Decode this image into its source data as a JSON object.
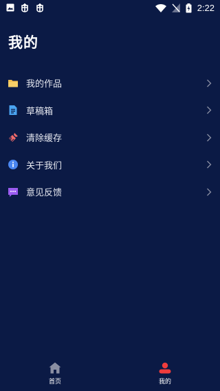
{
  "status_bar": {
    "time": "2:22",
    "icons": [
      "image-icon",
      "bug-icon",
      "bug-icon",
      "wifi-icon",
      "no-signal-icon",
      "battery-charging-icon"
    ]
  },
  "page": {
    "title": "我的"
  },
  "menu": {
    "items": [
      {
        "label": "我的作品",
        "icon": "folder-icon",
        "color": "#f4c050"
      },
      {
        "label": "草稿箱",
        "icon": "document-icon",
        "color": "#4aa3f0"
      },
      {
        "label": "清除缓存",
        "icon": "broom-icon",
        "color": "#f06a6a"
      },
      {
        "label": "关于我们",
        "icon": "info-icon",
        "color": "#4a86f0"
      },
      {
        "label": "意见反馈",
        "icon": "feedback-icon",
        "color": "#9b5cf0"
      }
    ]
  },
  "tab_bar": {
    "tabs": [
      {
        "label": "首页",
        "icon": "home-icon",
        "active": false
      },
      {
        "label": "我的",
        "icon": "profile-icon",
        "active": true
      }
    ],
    "active_color": "#f03c3c",
    "inactive_color": "#8a8fa3"
  }
}
